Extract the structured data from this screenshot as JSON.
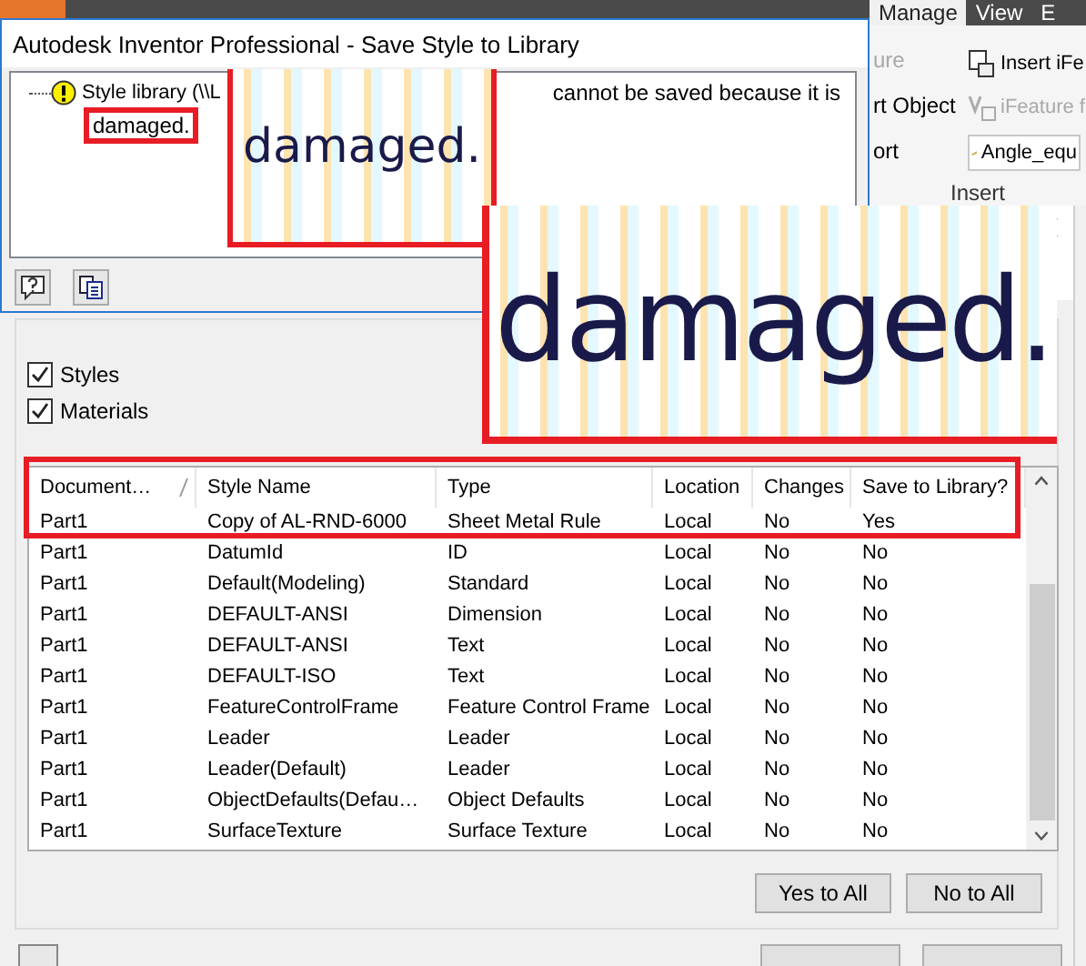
{
  "ribbon": {
    "tabs": [
      {
        "label": "Manage",
        "selected": true
      },
      {
        "label": "View",
        "selected": false
      },
      {
        "label": "E",
        "selected": false
      }
    ],
    "left_items": [
      {
        "label": "ure",
        "disabled": true
      },
      {
        "label": "rt Object",
        "disabled": false
      },
      {
        "label": "ort",
        "disabled": false
      }
    ],
    "right_items": [
      {
        "kind": "button",
        "label": "Insert iFe",
        "disabled": false
      },
      {
        "kind": "button",
        "label": "iFeature f",
        "disabled": true
      },
      {
        "kind": "dropdown",
        "label": "Angle_equ",
        "disabled": false
      }
    ],
    "group_label": "Insert"
  },
  "message_dialog": {
    "title": "Autodesk Inventor Professional - Save Style to Library",
    "message_start": "Style library (\\\\L",
    "message_end": "cannot be saved because it is",
    "message_last": "damaged."
  },
  "zoom_insets": [
    "damaged.",
    "damaged."
  ],
  "save_dialog": {
    "checkboxes": [
      {
        "label": "Styles",
        "checked": true
      },
      {
        "label": "Materials",
        "checked": true
      }
    ],
    "table": {
      "columns": [
        {
          "label": "Document…",
          "sorted": true
        },
        {
          "label": "Style Name",
          "sorted": false
        },
        {
          "label": "Type",
          "sorted": false
        },
        {
          "label": "Location",
          "sorted": false
        },
        {
          "label": "Changes",
          "sorted": false
        },
        {
          "label": "Save to Library?",
          "sorted": false
        }
      ],
      "rows": [
        [
          "Part1",
          "Copy of AL-RND-6000",
          "Sheet Metal Rule",
          "Local",
          "No",
          "Yes"
        ],
        [
          "Part1",
          "DatumId",
          "ID",
          "Local",
          "No",
          "No"
        ],
        [
          "Part1",
          "Default(Modeling)",
          "Standard",
          "Local",
          "No",
          "No"
        ],
        [
          "Part1",
          "DEFAULT-ANSI",
          "Dimension",
          "Local",
          "No",
          "No"
        ],
        [
          "Part1",
          "DEFAULT-ANSI",
          "Text",
          "Local",
          "No",
          "No"
        ],
        [
          "Part1",
          "DEFAULT-ISO",
          "Text",
          "Local",
          "No",
          "No"
        ],
        [
          "Part1",
          "FeatureControlFrame",
          "Feature Control Frame",
          "Local",
          "No",
          "No"
        ],
        [
          "Part1",
          "Leader",
          "Leader",
          "Local",
          "No",
          "No"
        ],
        [
          "Part1",
          "Leader(Default)",
          "Leader",
          "Local",
          "No",
          "No"
        ],
        [
          "Part1",
          "ObjectDefaults(Defau…",
          "Object Defaults",
          "Local",
          "No",
          "No"
        ],
        [
          "Part1",
          "SurfaceTexture",
          "Surface Texture",
          "Local",
          "No",
          "No"
        ]
      ]
    },
    "buttons": [
      "Yes to All",
      "No to All"
    ]
  }
}
